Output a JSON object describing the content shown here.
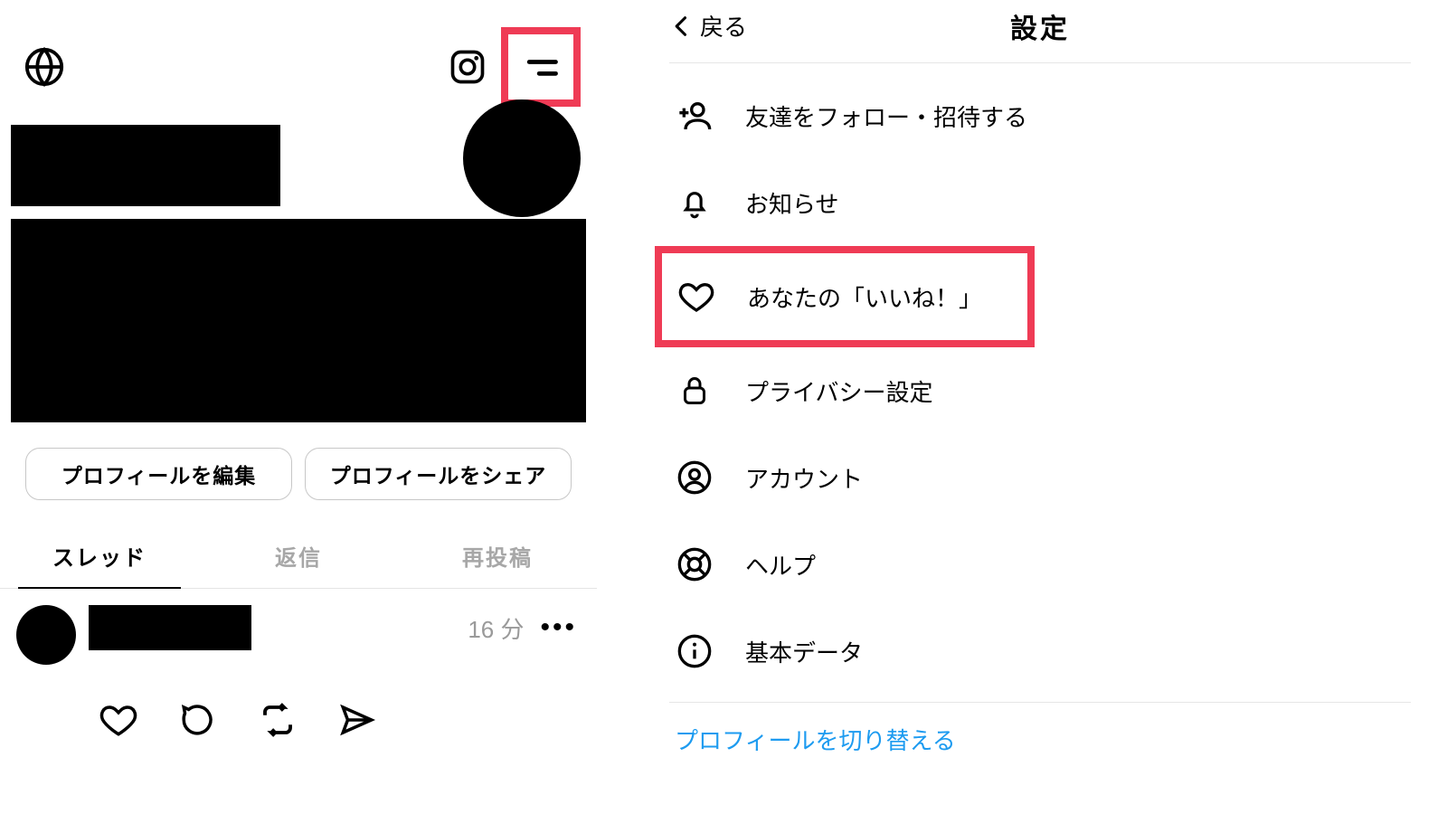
{
  "left": {
    "edit_label": "プロフィールを編集",
    "share_label": "プロフィールをシェア",
    "tabs": [
      "スレッド",
      "返信",
      "再投稿"
    ],
    "post_time": "16 分"
  },
  "right": {
    "back_label": "戻る",
    "title": "設定",
    "items": [
      "友達をフォロー・招待する",
      "お知らせ",
      "あなたの「いいね！」",
      "プライバシー設定",
      "アカウント",
      "ヘルプ",
      "基本データ"
    ],
    "switch_label": "プロフィールを切り替える"
  }
}
